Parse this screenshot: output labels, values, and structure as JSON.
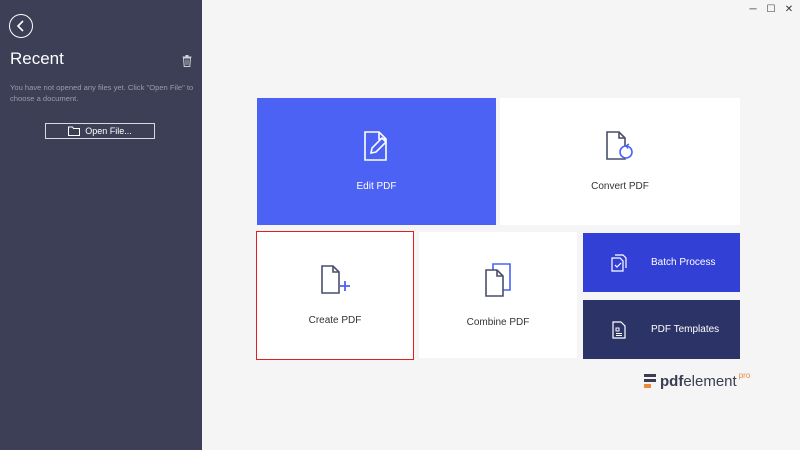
{
  "sidebar": {
    "title": "Recent",
    "hint": "You have not opened any files yet. Click \"Open File\" to choose a document.",
    "open_file_label": "Open File..."
  },
  "window_controls": {
    "minimize": "─",
    "maximize": "☐",
    "close": "✕"
  },
  "tiles": {
    "edit": "Edit PDF",
    "convert": "Convert PDF",
    "create": "Create PDF",
    "combine": "Combine PDF",
    "batch": "Batch Process",
    "templates": "PDF Templates"
  },
  "brand": {
    "pdf": "pdf",
    "element": "element",
    "pro": "pro"
  },
  "colors": {
    "sidebar_bg": "#3c3f56",
    "edit_tile": "#4b62f5",
    "batch_tile": "#3340d6",
    "templates_tile": "#2c3366",
    "selection_border": "#e02020",
    "pro_accent": "#e88c3b"
  }
}
